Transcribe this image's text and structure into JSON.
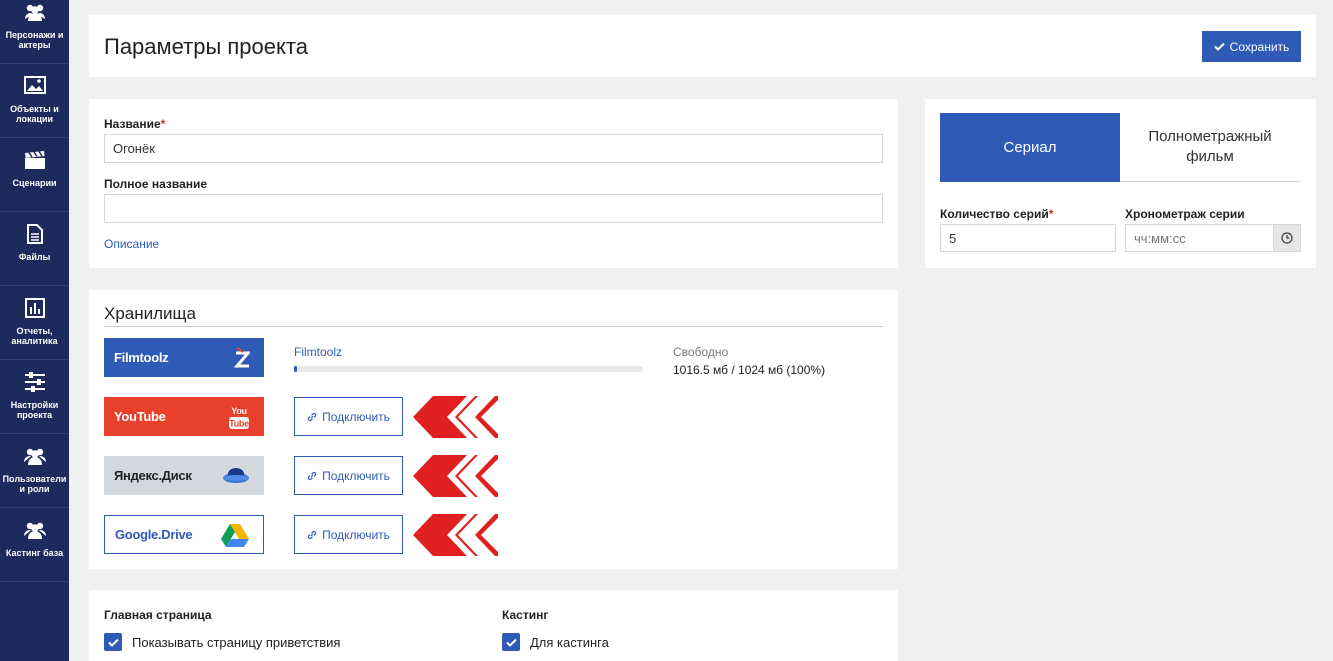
{
  "sidebar": {
    "items": [
      {
        "label": "Персонажи и актеры",
        "icon": "users-icon"
      },
      {
        "label": "Объекты и локации",
        "icon": "image-icon"
      },
      {
        "label": "Сценарии",
        "icon": "clapperboard-icon"
      },
      {
        "label": "Файлы",
        "icon": "file-icon"
      },
      {
        "label": "Отчеты, аналитика",
        "icon": "chart-icon"
      },
      {
        "label": "Настройки проекта",
        "icon": "sliders-icon"
      },
      {
        "label": "Пользователи и роли",
        "icon": "users-icon"
      },
      {
        "label": "Кастинг база",
        "icon": "users-icon"
      }
    ]
  },
  "header": {
    "title": "Параметры проекта",
    "save_label": "Сохранить"
  },
  "project": {
    "name_label": "Название",
    "name_value": "Огонёк",
    "full_name_label": "Полное название",
    "full_name_value": "",
    "description_link": "Описание",
    "required_mark": "*"
  },
  "project_type": {
    "tabs": [
      {
        "label": "Сериал",
        "active": true
      },
      {
        "label": "Полнометражный фильм",
        "active": false
      }
    ],
    "episodes_label": "Количество серий",
    "episodes_value": "5",
    "duration_label": "Хронометраж серии",
    "duration_placeholder": "чч:мм:сс"
  },
  "storage": {
    "title": "Хранилища",
    "connect_label": "Подключить",
    "services": [
      {
        "name": "Filmtoolz",
        "icon": "filmtoolz-logo-icon"
      },
      {
        "name": "YouTube",
        "icon": "youtube-logo-icon"
      },
      {
        "name": "Яндекс.Диск",
        "icon": "yandex-disk-icon"
      },
      {
        "name": "Google.Drive",
        "icon": "google-drive-icon"
      }
    ],
    "filmtoolz": {
      "name": "Filmtoolz",
      "free_label": "Свободно",
      "free_value": "1016.5 мб / 1024 мб (100%)",
      "used_fraction": 0.0073
    }
  },
  "settings": {
    "main_page_label": "Главная страница",
    "show_welcome_label": "Показывать страницу приветствия",
    "show_welcome_checked": true,
    "casting_label": "Кастинг",
    "for_casting_label": "Для кастинга",
    "for_casting_checked": true
  },
  "colors": {
    "sidebar_bg": "#1c2a5c",
    "accent": "#2f5bb7",
    "youtube": "#e8402a",
    "yandex": "#d4d9df",
    "arrow_red": "#e02020"
  }
}
